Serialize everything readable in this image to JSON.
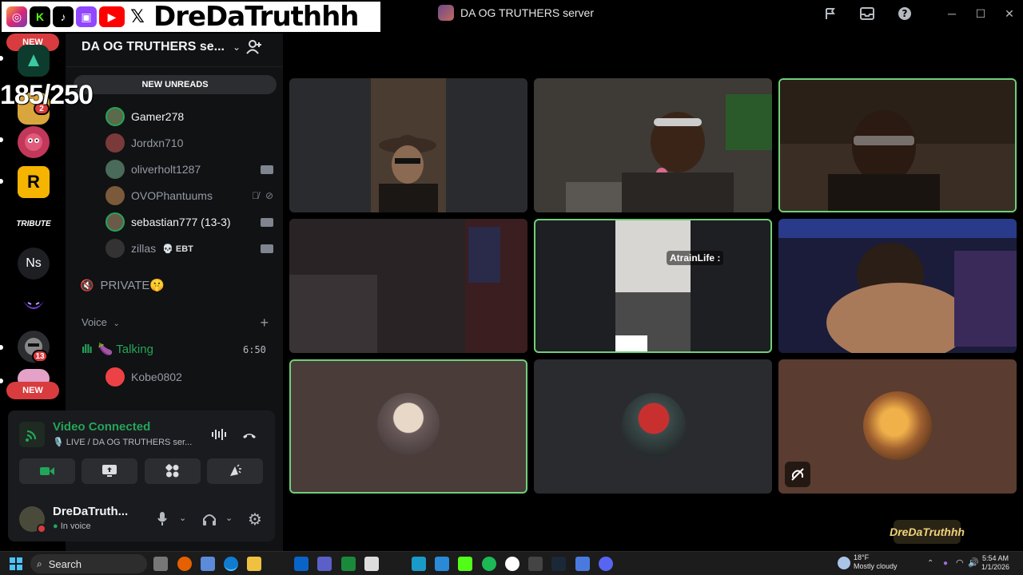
{
  "banner": {
    "handle": "DreDaTruthhh",
    "social_icons": [
      "instagram-icon",
      "kick-icon",
      "tiktok-icon",
      "twitch-icon",
      "youtube-icon",
      "x-icon"
    ]
  },
  "overlay": {
    "viewer_count": "185/250"
  },
  "titlebar": {
    "server_title": "DA OG TRUTHERS server"
  },
  "rail": {
    "new_top": "NEW",
    "new_bottom": "NEW",
    "badge_2": "2",
    "badge_13": "13",
    "ns_label": "Ns",
    "tribute_label": "TRIBUTE"
  },
  "sidebar": {
    "server_name": "DA OG TRUTHERS se...",
    "new_unreads": "NEW UNREADS",
    "members": [
      {
        "name": "Gamer278",
        "active": true,
        "color": "#5a6a4a"
      },
      {
        "name": "Jordxn710",
        "active": false,
        "color": "#7a3a3a"
      },
      {
        "name": "oliverholt1287",
        "active": false,
        "color": "#4a6a5a"
      },
      {
        "name": "OVOPhantuums",
        "active": false,
        "color": "#7a5a3a"
      },
      {
        "name": "sebastian777 (13-3)",
        "active": true,
        "color": "#6a5a4a"
      },
      {
        "name": "zillas",
        "active": false,
        "color": "#333333",
        "tag": "💀 EBT"
      }
    ],
    "private_channel": "PRIVATE🤫",
    "voice_category": "Voice",
    "voice_channel": "🍆 Talking",
    "voice_timer": "6:50",
    "voice_member": "Kobe0802"
  },
  "voice_panel": {
    "status": "Video Connected",
    "sub": "🎙️ LIVE / DA OG TRUTHERS ser...",
    "user_name": "DreDaTruth...",
    "user_status": "In voice"
  },
  "tiles": [
    {
      "id": "t1",
      "bg": "#2a2b2e",
      "speaking": false
    },
    {
      "id": "t2",
      "bg": "#3a3836",
      "speaking": false
    },
    {
      "id": "t3",
      "bg": "#2e2620",
      "speaking": true
    },
    {
      "id": "t4",
      "bg": "#2a2224",
      "speaking": false
    },
    {
      "id": "t5",
      "bg": "#1e1f22",
      "speaking": true,
      "name": "AtrainLife :"
    },
    {
      "id": "t6",
      "bg": "#1c1e3a",
      "speaking": false
    },
    {
      "id": "t7",
      "bg": "#4a3c38",
      "speaking": true
    },
    {
      "id": "t8",
      "bg": "#2a2b2e",
      "speaking": false
    },
    {
      "id": "t9",
      "bg": "#5a3c30",
      "speaking": false
    }
  ],
  "taskbar": {
    "search": "Search",
    "weather_temp": "18°F",
    "weather_desc": "Mostly cloudy",
    "time": "5:54 AM",
    "date": "1/1/2026"
  },
  "watermark": "DreDaTruthhh"
}
